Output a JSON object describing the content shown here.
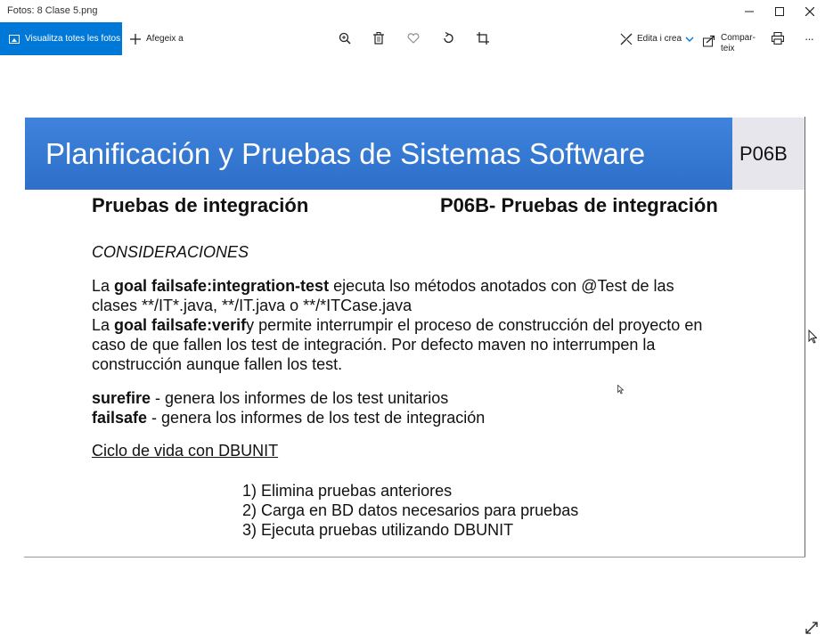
{
  "window": {
    "title": "Fotos: 8 Clase 5.png"
  },
  "toolbar": {
    "view_all_label": "Visualitza totes les fotos",
    "add_to_label": "Afegeix a",
    "edit_create_label": "Edita i crea",
    "share_label_line1": "Compar-",
    "share_label_line2": "teix",
    "more_label": "···"
  },
  "slide": {
    "banner_title": "Planificación y Pruebas de Sistemas Software",
    "code": "P06B",
    "heading_left": "Pruebas de integración",
    "heading_right": "P06B- Pruebas de integración",
    "considerations": "CONSIDERACIONES",
    "para1": {
      "l1_a": "La ",
      "l1_b": "goal failsafe:integration-test",
      "l1_c": " ejecuta lso métodos anotados con @Test de las",
      "l2": "clases **/IT*.java, **/IT.java o **/*ITCase.java",
      "l3_a": "La ",
      "l3_b": "goal failsafe:verif",
      "l3_c": "y permite interrumpir el proceso de construcción del proyecto en",
      "l4": "caso de que fallen los test de integración. Por defecto maven no interrumpen la",
      "l5": "construcción aunque fallen los test."
    },
    "surefire_bold": "surefire",
    "surefire_text": " - genera los informes de los test unitarios",
    "failsafe_bold": "failsafe",
    "failsafe_text": " - genera los informes de los test de integración",
    "cycle_heading": "Ciclo de vida con DBUNIT",
    "steps": [
      "1)  Elimina pruebas anteriores",
      "2)  Carga en BD datos necesarios para pruebas",
      "3)  Ejecuta pruebas utilizando DBUNIT"
    ]
  },
  "colors": {
    "accent": "#0078d7",
    "banner": "#3a7bd5",
    "code_box": "#e6e6ec"
  }
}
